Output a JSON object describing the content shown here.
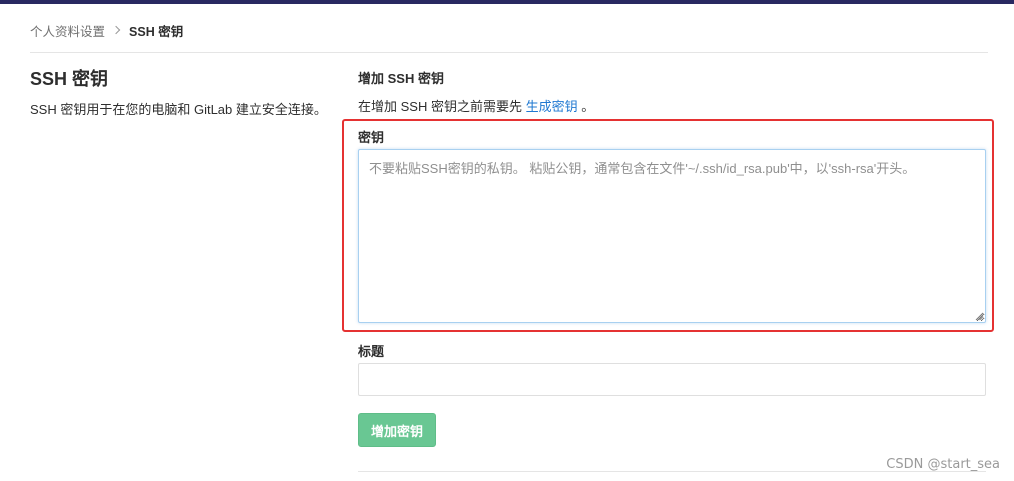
{
  "breadcrumb": {
    "parent": "个人资料设置",
    "current": "SSH 密钥"
  },
  "sidebar": {
    "title": "SSH 密钥",
    "description": "SSH 密钥用于在您的电脑和 GitLab 建立安全连接。"
  },
  "form": {
    "heading": "增加 SSH 密钥",
    "intro_prefix": "在增加 SSH 密钥之前需要先",
    "intro_link": "生成密钥",
    "intro_suffix": "。",
    "key_label": "密钥",
    "key_placeholder": "不要粘贴SSH密钥的私钥。 粘贴公钥，通常包含在文件'~/.ssh/id_rsa.pub'中，以'ssh-rsa'开头。",
    "key_value": "",
    "title_label": "标题",
    "title_value": "",
    "submit_label": "增加密钥"
  },
  "watermark": "CSDN @start_sea",
  "colors": {
    "topbar": "#292961",
    "link": "#1f78d1",
    "submit_button": "#69c793",
    "highlight_box": "#e53232"
  }
}
